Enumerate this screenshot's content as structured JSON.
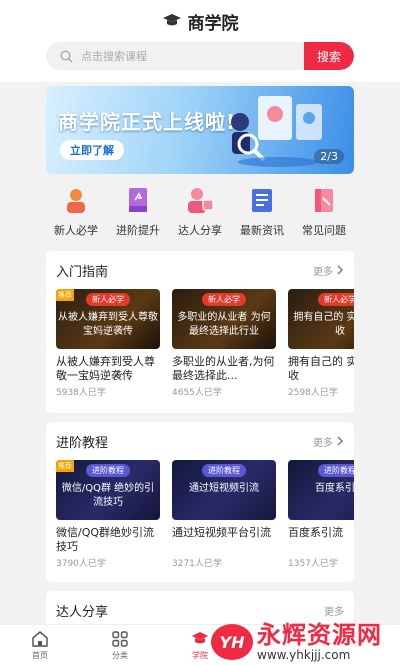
{
  "header": {
    "title": "商学院"
  },
  "search": {
    "placeholder": "点击搜索课程",
    "button_label": "搜索"
  },
  "banner": {
    "title": "商学院正式上线啦!",
    "button_label": "立即了解",
    "pager": "2/3"
  },
  "categories": [
    {
      "label": "新人必学",
      "icon": "newbie-icon",
      "color": "#f58a3a"
    },
    {
      "label": "进阶提升",
      "icon": "advance-book-icon",
      "color": "#a75ad8"
    },
    {
      "label": "达人分享",
      "icon": "expert-share-icon",
      "color": "#f0577a"
    },
    {
      "label": "最新资讯",
      "icon": "news-icon",
      "color": "#5a7ee8"
    },
    {
      "label": "常见问题",
      "icon": "faq-icon",
      "color": "#f0577a"
    }
  ],
  "sections": [
    {
      "title": "入门指南",
      "more_label": "更多",
      "courses": [
        {
          "thumb_tag": "新人必学",
          "thumb_text": "从被人嫌弃到受人尊敬 宝妈逆袭传",
          "name": "从被人嫌弃到受人尊敬一宝妈逆袭传",
          "count": "5938人已学",
          "recommended": "推荐"
        },
        {
          "thumb_tag": "新人必学",
          "thumb_text": "多职业的从业者 为何最终选择此行业",
          "name": "多职业的从业者,为何最终选择此...",
          "count": "4655人已学"
        },
        {
          "thumb_tag": "新人必学",
          "thumb_text": "拥有自己的 实现经济收",
          "name": "拥有自己的 实现经济收",
          "count": "2598人已学"
        }
      ]
    },
    {
      "title": "进阶教程",
      "more_label": "更多",
      "courses": [
        {
          "thumb_tag": "进阶教程",
          "thumb_text": "微信/QQ群 绝妙的引流技巧",
          "name": "微信/QQ群绝妙引流技巧",
          "count": "3790人已学",
          "recommended": "推荐"
        },
        {
          "thumb_tag": "进阶教程",
          "thumb_text": "通过短视频引流",
          "name": "通过短视频平台引流",
          "count": "3271人已学"
        },
        {
          "thumb_tag": "进阶教程",
          "thumb_text": "百度系引流",
          "name": "百度系引流",
          "count": "1357人已学"
        }
      ]
    },
    {
      "title": "达人分享",
      "more_label": "更多"
    }
  ],
  "tabbar": [
    {
      "label": "首页",
      "icon": "home-icon"
    },
    {
      "label": "分类",
      "icon": "grid-icon"
    },
    {
      "label": "学院",
      "icon": "college-icon",
      "active": true
    }
  ],
  "watermark": {
    "logo": "YH",
    "text": "永辉资源网",
    "url": "www.yhkjjj.com"
  },
  "colors": {
    "accent": "#f02a42",
    "banner": "#3a8ee8"
  }
}
